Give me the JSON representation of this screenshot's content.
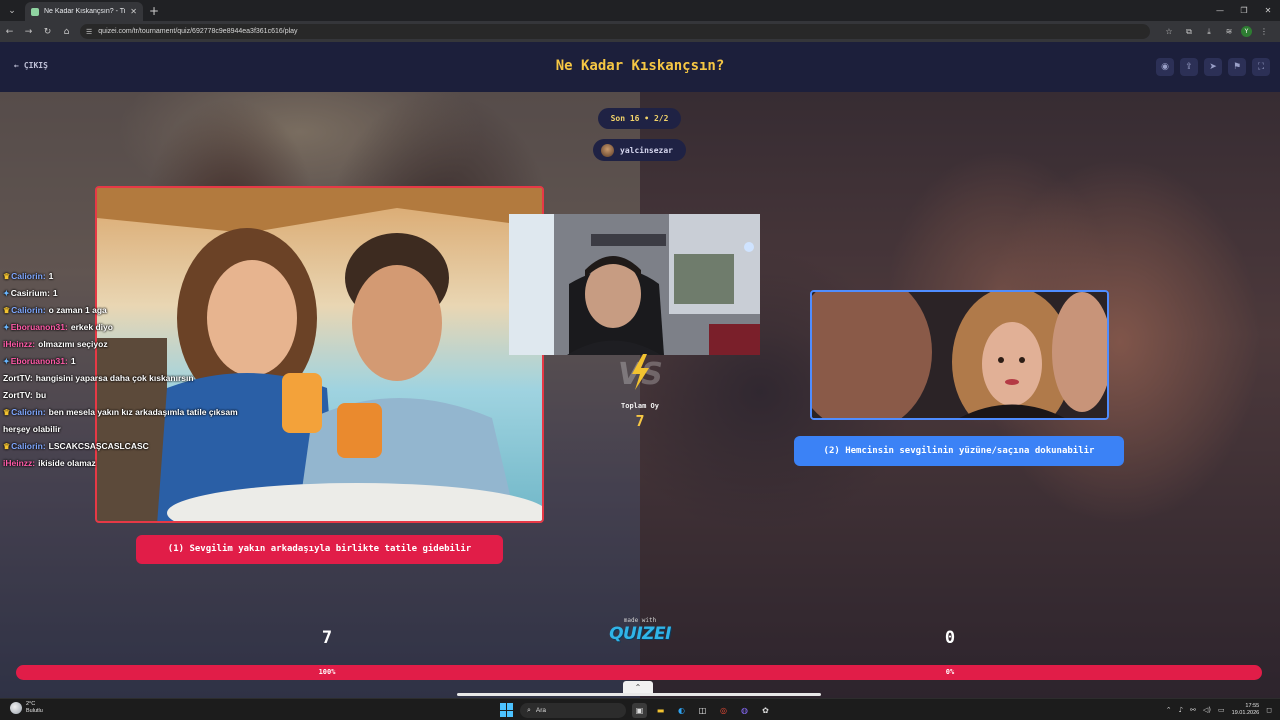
{
  "browser": {
    "tab_title": "Ne Kadar Kıskançsın? - Tier Lis...",
    "url": "quizei.com/tr/tournament/quiz/692778c9e8944ea3f361c616/play"
  },
  "header": {
    "exit_label": "ÇIKIŞ",
    "title": "Ne Kadar Kıskançsın?"
  },
  "round": {
    "label": "Son 16 • 2/2"
  },
  "author": {
    "name": "yalcinsezar"
  },
  "choices": {
    "left": {
      "label": "(1) Sevgilim yakın arkadaşıyla birlikte tatile gidebilir",
      "votes": "7",
      "percent": "100%",
      "share": 1.0,
      "color": "#e11d48"
    },
    "right": {
      "label": "(2) Hemcinsin sevgilinin yüzüne/saçına dokunabilir",
      "votes": "0",
      "percent": "0%",
      "share": 0.0,
      "color": "#3b82f6"
    }
  },
  "total": {
    "label": "Toplam Oy",
    "value": "7"
  },
  "footer": {
    "made_with": "made with",
    "brand": "QUIZEI"
  },
  "chat": [
    {
      "badge": "crown",
      "user": "Caliorin:",
      "user_color": "#7fa8ff",
      "text": "1"
    },
    {
      "badge": "sword",
      "user": "Casirium:",
      "user_color": "#ffffff",
      "text": "1"
    },
    {
      "badge": "crown",
      "user": "Caliorin:",
      "user_color": "#7fa8ff",
      "text": "o zaman 1 aga"
    },
    {
      "badge": "sword",
      "user": "Eboruanon31:",
      "user_color": "#ff5aa8",
      "text": "erkek diyo"
    },
    {
      "badge": "",
      "user": "iHeinzz:",
      "user_color": "#ff5aa8",
      "text": "olmazımı seçiyoz"
    },
    {
      "badge": "sword",
      "user": "Eboruanon31:",
      "user_color": "#ff5aa8",
      "text": "1"
    },
    {
      "badge": "",
      "user": "ZortTV:",
      "user_color": "#ffffff",
      "text": "hangisini yaparsa daha çok kıskanırsın"
    },
    {
      "badge": "",
      "user": "ZortTV:",
      "user_color": "#ffffff",
      "text": "bu"
    },
    {
      "badge": "crown",
      "user": "Caliorin:",
      "user_color": "#7fa8ff",
      "text": "ben mesela yakın kız arkadaşımla tatile çıksam herşey olabilir"
    },
    {
      "badge": "crown",
      "user": "Caliorin:",
      "user_color": "#7fa8ff",
      "text": "LSCAKCSAŞCASLCASC"
    },
    {
      "badge": "",
      "user": "iHeinzz:",
      "user_color": "#ff5aa8",
      "text": "ikiside olamaz"
    }
  ],
  "taskbar": {
    "temp": "2°C",
    "condition": "Bulutlu",
    "search": "Ara",
    "time": "17:55",
    "date": "19.01.2026"
  },
  "icons": {
    "exit": "arrow-left-icon",
    "header": [
      "eye-icon",
      "share-icon",
      "send-icon",
      "flag-icon",
      "fullscreen-icon"
    ]
  }
}
